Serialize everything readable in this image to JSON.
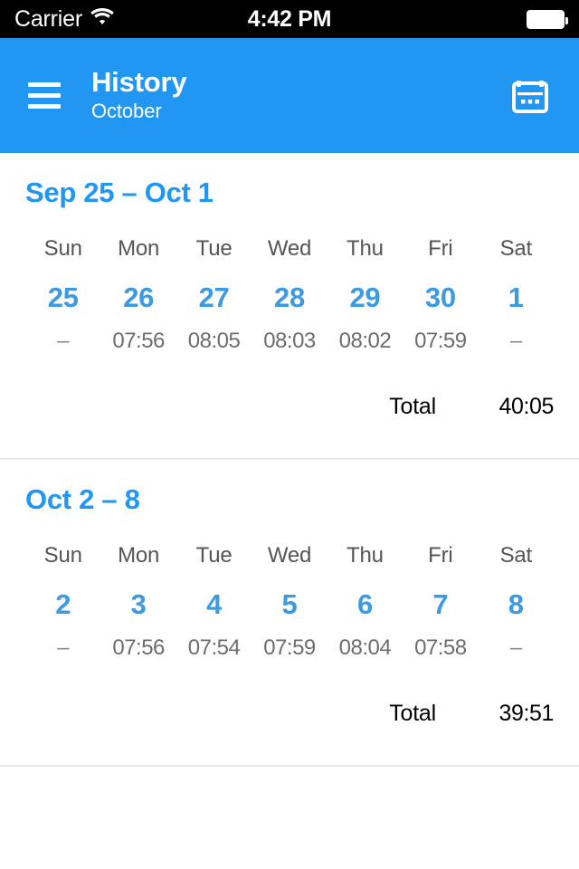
{
  "status_bar": {
    "carrier": "Carrier",
    "wifi_icon": "wifi-icon",
    "time": "4:42 PM",
    "battery_icon": "battery-full-icon"
  },
  "app_bar": {
    "menu_icon": "hamburger-menu-icon",
    "title": "History",
    "subtitle": "October",
    "calendar_icon": "calendar-icon",
    "background_color": "#2196f3"
  },
  "theme": {
    "accent_blue": "#2196f3",
    "date_blue": "#3d9ae0",
    "muted_gray": "#6d6d6d",
    "divider": "#e8e8e8"
  },
  "weeks": [
    {
      "range_label": "Sep 25 – Oct 1",
      "days": [
        {
          "dow": "Sun",
          "date": "25",
          "time": "–",
          "has_entry": false
        },
        {
          "dow": "Mon",
          "date": "26",
          "time": "07:56",
          "has_entry": true
        },
        {
          "dow": "Tue",
          "date": "27",
          "time": "08:05",
          "has_entry": true
        },
        {
          "dow": "Wed",
          "date": "28",
          "time": "08:03",
          "has_entry": true
        },
        {
          "dow": "Thu",
          "date": "29",
          "time": "08:02",
          "has_entry": true
        },
        {
          "dow": "Fri",
          "date": "30",
          "time": "07:59",
          "has_entry": true
        },
        {
          "dow": "Sat",
          "date": "1",
          "time": "–",
          "has_entry": false
        }
      ],
      "total_label": "Total",
      "total_value": "40:05"
    },
    {
      "range_label": "Oct 2 – 8",
      "days": [
        {
          "dow": "Sun",
          "date": "2",
          "time": "–",
          "has_entry": false
        },
        {
          "dow": "Mon",
          "date": "3",
          "time": "07:56",
          "has_entry": true
        },
        {
          "dow": "Tue",
          "date": "4",
          "time": "07:54",
          "has_entry": true
        },
        {
          "dow": "Wed",
          "date": "5",
          "time": "07:59",
          "has_entry": true
        },
        {
          "dow": "Thu",
          "date": "6",
          "time": "08:04",
          "has_entry": true
        },
        {
          "dow": "Fri",
          "date": "7",
          "time": "07:58",
          "has_entry": true
        },
        {
          "dow": "Sat",
          "date": "8",
          "time": "–",
          "has_entry": false
        }
      ],
      "total_label": "Total",
      "total_value": "39:51"
    }
  ]
}
